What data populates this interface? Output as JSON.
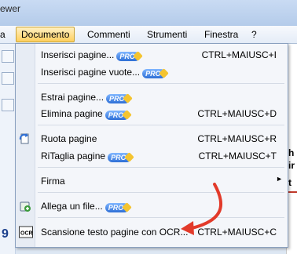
{
  "window": {
    "title_fragment": "ewer"
  },
  "menubar": {
    "items": [
      {
        "label": "a"
      },
      {
        "label": "Documento"
      },
      {
        "label": "Commenti"
      },
      {
        "label": "Strumenti"
      },
      {
        "label": "Finestra"
      },
      {
        "label": "?"
      }
    ]
  },
  "dropdown": {
    "pro_badge": "PRO",
    "items": [
      {
        "label": "Inserisci pagine...",
        "shortcut": "CTRL+MAIUSC+I"
      },
      {
        "label": "Inserisci pagine vuote...",
        "shortcut": ""
      },
      {
        "label": "Estrai pagine...",
        "shortcut": ""
      },
      {
        "label": "Elimina pagine",
        "shortcut": "CTRL+MAIUSC+D"
      },
      {
        "label": "Ruota pagine",
        "shortcut": "CTRL+MAIUSC+R"
      },
      {
        "label": "RiTaglia pagine",
        "shortcut": "CTRL+MAIUSC+T"
      },
      {
        "label": "Firma",
        "shortcut": ""
      },
      {
        "label": "Allega un file...",
        "shortcut": ""
      },
      {
        "label": "Scansione testo pagine con OCR...",
        "shortcut": "CTRL+MAIUSC+C"
      }
    ]
  },
  "background": {
    "left_edge_text": "9",
    "right_edge_texts": [
      "h",
      "ir",
      "t"
    ]
  },
  "colors": {
    "menu_highlight": "#ffcf5e",
    "annotation_arrow": "#e23a2a",
    "pro_badge": "#2e6fd6"
  }
}
